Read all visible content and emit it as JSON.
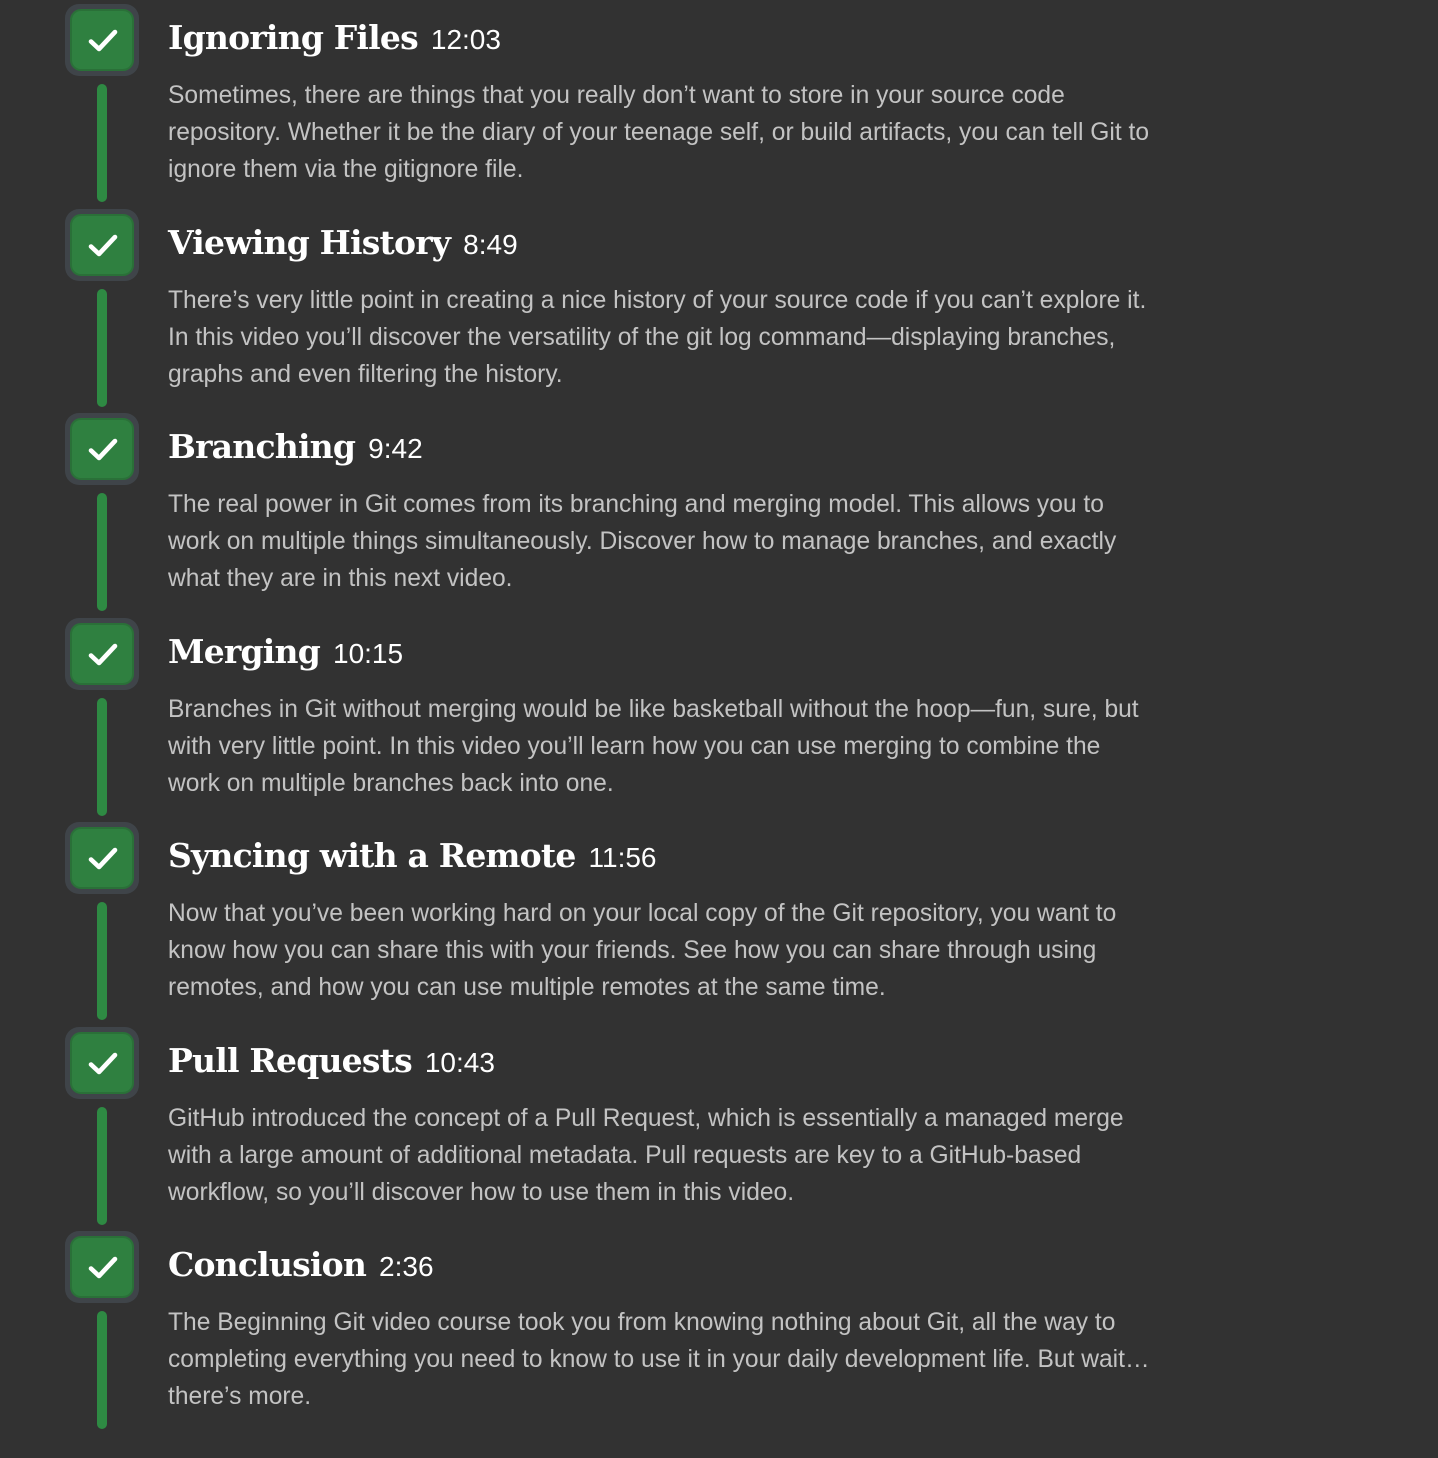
{
  "lessons": [
    {
      "title": "Ignoring Files",
      "duration": "12:03",
      "description": "Sometimes, there are things that you really don’t want to store in your source code repository. Whether it be the diary of your teenage self, or build artifacts, you can tell Git to ignore them via the gitignore file.",
      "completed": true
    },
    {
      "title": "Viewing History",
      "duration": "8:49",
      "description": "There’s very little point in creating a nice history of your source code if you can’t explore it. In this video you’ll discover the versatility of the git log command—displaying branches, graphs and even filtering the history.",
      "completed": true
    },
    {
      "title": "Branching",
      "duration": "9:42",
      "description": "The real power in Git comes from its branching and merging model. This allows you to work on multiple things simultaneously. Discover how to manage branches, and exactly what they are in this next video.",
      "completed": true
    },
    {
      "title": "Merging",
      "duration": "10:15",
      "description": "Branches in Git without merging would be like basketball without the hoop—fun, sure, but with very little point. In this video you’ll learn how you can use merging to combine the work on multiple branches back into one.",
      "completed": true
    },
    {
      "title": "Syncing with a Remote",
      "duration": "11:56",
      "description": "Now that you’ve been working hard on your local copy of the Git repository, you want to know how you can share this with your friends. See how you can share through using remotes, and how you can use multiple remotes at the same time.",
      "completed": true
    },
    {
      "title": "Pull Requests",
      "duration": "10:43",
      "description": "GitHub introduced the concept of a Pull Request, which is essentially a managed merge with a large amount of additional metadata. Pull requests are key to a GitHub-based workflow, so you’ll discover how to use them in this video.",
      "completed": true
    },
    {
      "title": "Conclusion",
      "duration": "2:36",
      "description": "The Beginning Git video course took you from knowing nothing about Git, all the way to completing everything you need to know to use it in your daily development life. But wait… there’s more.",
      "completed": true
    }
  ],
  "icons": {
    "completed": "checkmark-icon"
  },
  "colors": {
    "background": "#323232",
    "check_fill": "#2f8040",
    "check_ring": "#3f4449",
    "connector": "#2e8a43",
    "title": "#ffffff",
    "description": "#c3c3c3"
  }
}
